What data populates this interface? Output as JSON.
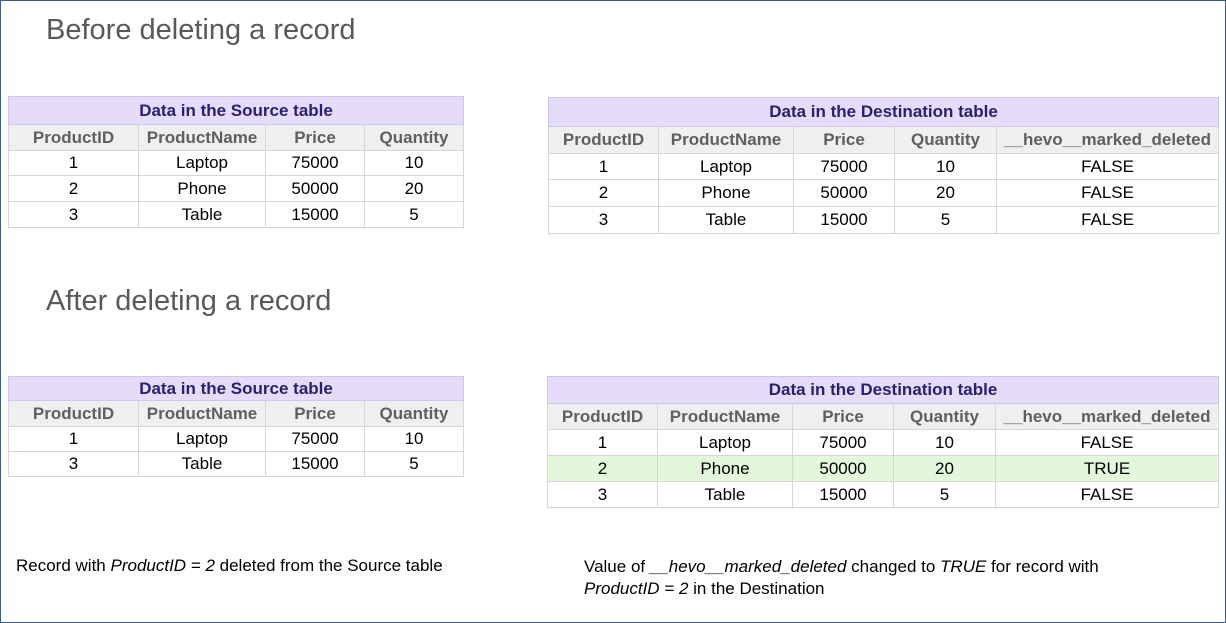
{
  "headings": {
    "before": "Before deleting a record",
    "after": "After deleting a record"
  },
  "source_caption": "Data in the Source table",
  "destination_caption": "Data in the Destination table",
  "source_columns": [
    "ProductID",
    "ProductName",
    "Price",
    "Quantity"
  ],
  "destination_columns": [
    "ProductID",
    "ProductName",
    "Price",
    "Quantity",
    "__hevo__marked_deleted"
  ],
  "before_source_rows": [
    [
      "1",
      "Laptop",
      "75000",
      "10"
    ],
    [
      "2",
      "Phone",
      "50000",
      "20"
    ],
    [
      "3",
      "Table",
      "15000",
      "5"
    ]
  ],
  "before_destination_rows": [
    [
      "1",
      "Laptop",
      "75000",
      "10",
      "FALSE"
    ],
    [
      "2",
      "Phone",
      "50000",
      "20",
      "FALSE"
    ],
    [
      "3",
      "Table",
      "15000",
      "5",
      "FALSE"
    ]
  ],
  "after_source_rows": [
    [
      "1",
      "Laptop",
      "75000",
      "10"
    ],
    [
      "3",
      "Table",
      "15000",
      "5"
    ]
  ],
  "after_destination_rows": [
    [
      "1",
      "Laptop",
      "75000",
      "10",
      "FALSE"
    ],
    [
      "2",
      "Phone",
      "50000",
      "20",
      "TRUE"
    ],
    [
      "3",
      "Table",
      "15000",
      "5",
      "FALSE"
    ]
  ],
  "highlighted_row_color": "#e2f7dc",
  "caption_color": "#e4dcf8",
  "notes": {
    "left": {
      "t1": "Record with ",
      "t2": "ProductID = 2",
      "t3": " deleted from the Source table"
    },
    "right": {
      "t1": "Value of ",
      "t2": "__hevo__marked_deleted",
      "t3": " changed to ",
      "t4": "TRUE",
      "t5": " for record with",
      "t6": "ProductID = 2",
      "t7": " in the Destination"
    }
  }
}
